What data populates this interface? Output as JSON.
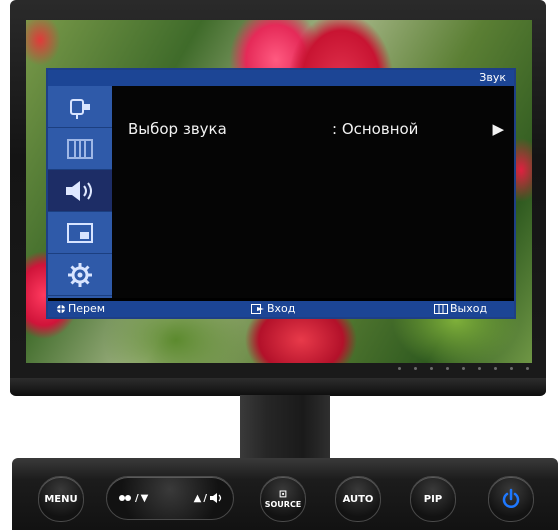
{
  "osd": {
    "title": "Звук",
    "menu_icons": [
      {
        "name": "input-icon",
        "active": false
      },
      {
        "name": "picture-icon",
        "active": false
      },
      {
        "name": "sound-icon",
        "active": true
      },
      {
        "name": "pip-icon",
        "active": false
      },
      {
        "name": "setup-icon",
        "active": false
      }
    ],
    "item": {
      "label": "Выбор звука",
      "value": ": Основной",
      "arrow": "▶"
    },
    "footer": {
      "move": "Перем",
      "enter": "Вход",
      "exit": "Выход"
    }
  },
  "buttons": {
    "menu": "MENU",
    "down": "▼",
    "up": "▲",
    "source_line1": "⊡",
    "source_line2": "SOURCE",
    "auto": "AUTO",
    "pip": "PIP"
  },
  "colors": {
    "osd_blue": "#1c4595",
    "icon_bar": "#2f5aa9",
    "power_accent": "#1e78ff"
  }
}
